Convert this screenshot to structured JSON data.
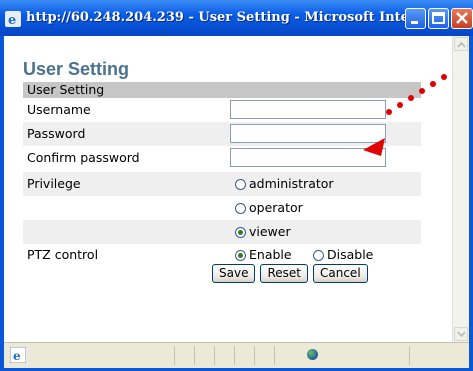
{
  "window": {
    "title": "http://60.248.204.239 - User Setting - Microsoft Inte..."
  },
  "page": {
    "title": "User Setting",
    "section_header": "User Setting"
  },
  "form": {
    "username_label": "Username",
    "username_value": "",
    "password_label": "Password",
    "password_value": "",
    "confirm_label": "Confirm password",
    "confirm_value": "",
    "privilege_label": "Privilege",
    "privilege_options": [
      {
        "label": "administrator",
        "checked": false
      },
      {
        "label": "operator",
        "checked": false
      },
      {
        "label": "viewer",
        "checked": true
      }
    ],
    "ptz_label": "PTZ control",
    "ptz_options": [
      {
        "label": "Enable",
        "checked": true
      },
      {
        "label": "Disable",
        "checked": false
      }
    ]
  },
  "buttons": {
    "save": "Save",
    "reset": "Reset",
    "cancel": "Cancel"
  },
  "colors": {
    "title_bar": "#0a5de6",
    "page_title": "#4a7290",
    "annotation": "#e00000"
  }
}
